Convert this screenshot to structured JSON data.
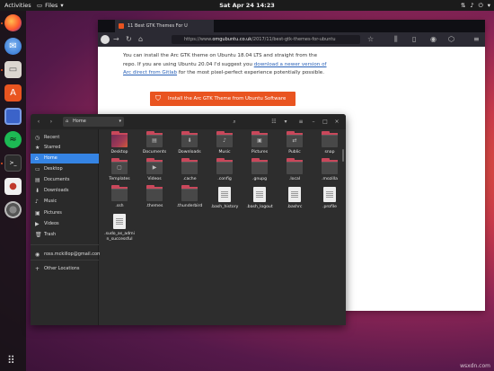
{
  "topbar": {
    "activities": "Activities",
    "app_menu": "Files",
    "clock": "Sat Apr 24  14:23"
  },
  "dock": {
    "apps": [
      "firefox-icon",
      "thunderbird-icon",
      "files-icon",
      "software-center-icon",
      "screenshot-icon",
      "spotify-icon",
      "terminal-icon",
      "pomodoro-icon",
      "settings-icon"
    ]
  },
  "browser": {
    "tab_title": "11 Best GTK Themes For U",
    "url_prefix": "https://www.",
    "url_domain": "omgubuntu.co.uk",
    "url_path": "/2017/11/best-gtk-themes-for-ubuntu",
    "text_1": "You can install the Arc GTK theme on Ubuntu 18.04 LTS and straight from the repo. If you are using Ubuntu 20.04 I'd suggest you ",
    "link_text": "download a newer version of Arc direct from Gitlab",
    "text_2": " for the most pixel-perfect experience potentially possible.",
    "button_label": "Install the Arc GTK Theme from Ubuntu Software"
  },
  "files": {
    "path": "Home",
    "sidebar": [
      {
        "label": "Recent",
        "icon": "clock-icon"
      },
      {
        "label": "Starred",
        "icon": "star-icon"
      },
      {
        "label": "Home",
        "icon": "home-icon",
        "active": true
      },
      {
        "label": "Desktop",
        "icon": "desktop-icon"
      },
      {
        "label": "Documents",
        "icon": "documents-icon"
      },
      {
        "label": "Downloads",
        "icon": "downloads-icon"
      },
      {
        "label": "Music",
        "icon": "music-icon"
      },
      {
        "label": "Pictures",
        "icon": "pictures-icon"
      },
      {
        "label": "Videos",
        "icon": "videos-icon"
      },
      {
        "label": "Trash",
        "icon": "trash-icon"
      },
      {
        "label": "ross.mckillop@gmail.com",
        "icon": "account-icon"
      },
      {
        "label": "Other Locations",
        "icon": "plus-icon"
      }
    ],
    "items": [
      {
        "label": "Desktop",
        "kind": "desktop"
      },
      {
        "label": "Documents",
        "kind": "folder",
        "glyph": "▤"
      },
      {
        "label": "Downloads",
        "kind": "folder",
        "glyph": "⬇"
      },
      {
        "label": "Music",
        "kind": "folder",
        "glyph": "♪"
      },
      {
        "label": "Pictures",
        "kind": "folder",
        "glyph": "▣"
      },
      {
        "label": "Public",
        "kind": "folder",
        "glyph": "⇄"
      },
      {
        "label": "snap",
        "kind": "folder",
        "glyph": ""
      },
      {
        "label": "Templates",
        "kind": "folder",
        "glyph": "▢"
      },
      {
        "label": "Videos",
        "kind": "folder",
        "glyph": "▶"
      },
      {
        "label": ".cache",
        "kind": "folder",
        "glyph": ""
      },
      {
        "label": ".config",
        "kind": "folder",
        "glyph": ""
      },
      {
        "label": ".gnupg",
        "kind": "folder",
        "glyph": ""
      },
      {
        "label": ".local",
        "kind": "folder",
        "glyph": ""
      },
      {
        "label": ".mozilla",
        "kind": "folder",
        "glyph": ""
      },
      {
        "label": ".ssh",
        "kind": "folder",
        "glyph": ""
      },
      {
        "label": ".themes",
        "kind": "folder",
        "glyph": ""
      },
      {
        "label": ".thunderbird",
        "kind": "folder",
        "glyph": ""
      },
      {
        "label": ".bash_history",
        "kind": "file"
      },
      {
        "label": ".bash_logout",
        "kind": "file"
      },
      {
        "label": ".bashrc",
        "kind": "file"
      },
      {
        "label": ".profile",
        "kind": "file"
      },
      {
        "label": ".sudo_as_admin_successful",
        "kind": "file"
      }
    ]
  },
  "watermark": "wsxdn.com",
  "colors": {
    "accent_orange": "#e95420",
    "selection_blue": "#3584e4",
    "folder_tab": "#c9485b"
  }
}
